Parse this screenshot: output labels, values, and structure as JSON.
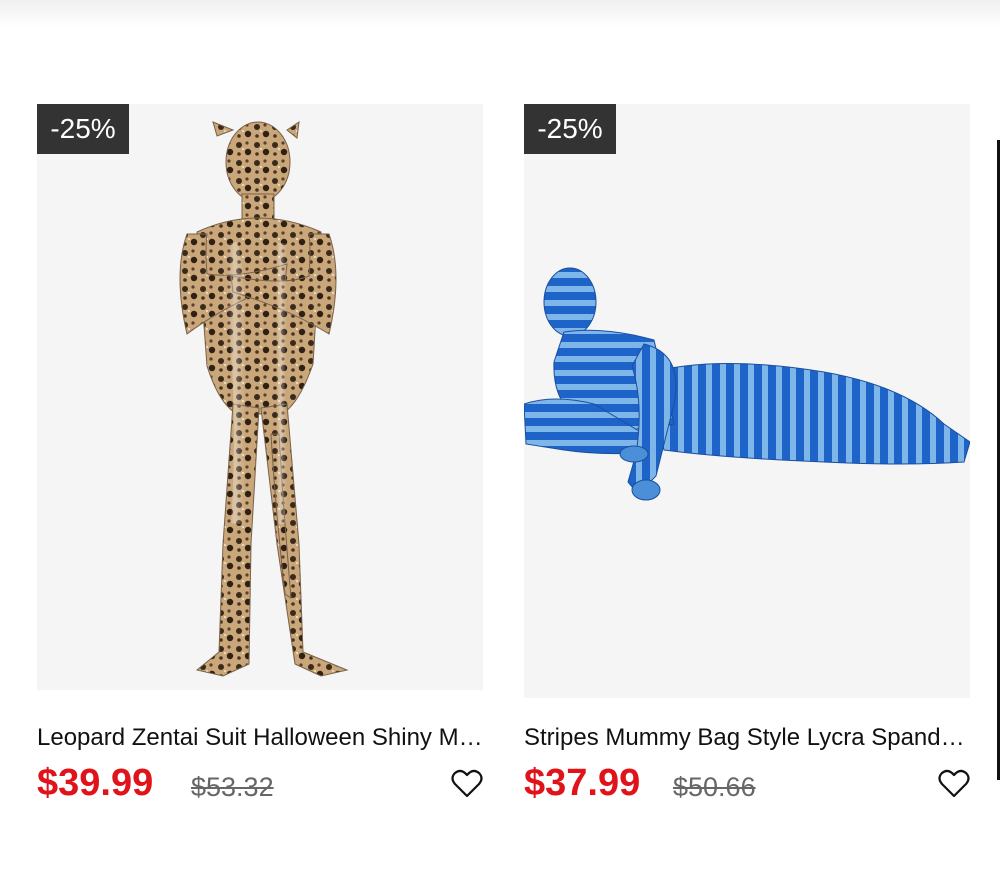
{
  "products": [
    {
      "badge": "-25%",
      "image_icon": "leopard-zentai-suit-image",
      "title": "Leopard Zentai Suit Halloween Shiny Metallic Catsuit",
      "price": "$39.99",
      "old_price": "$53.32"
    },
    {
      "badge": "-25%",
      "image_icon": "striped-mummy-bag-suit-image",
      "title": "Stripes Mummy Bag Style Lycra Spandex Zentai Suit",
      "price": "$37.99",
      "old_price": "$50.66"
    }
  ],
  "colors": {
    "sale_price": "#e0131a",
    "badge_bg": "#333333",
    "old_price": "#666666"
  }
}
